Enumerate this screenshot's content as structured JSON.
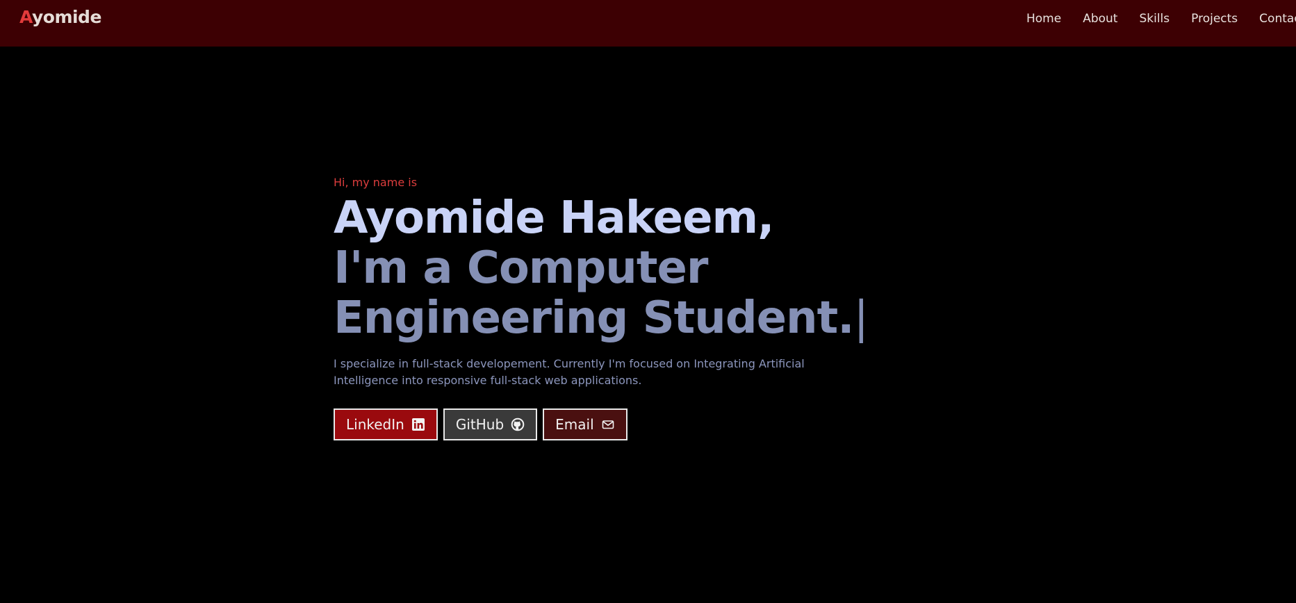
{
  "logo": {
    "initial": "A",
    "rest": "yomide"
  },
  "nav": {
    "items": [
      {
        "label": "Home"
      },
      {
        "label": "About"
      },
      {
        "label": "Skills"
      },
      {
        "label": "Projects"
      },
      {
        "label": "Contact"
      }
    ]
  },
  "hero": {
    "greeting": "Hi, my name is",
    "name_line": "Ayomide Hakeem,",
    "role_line1": "I'm a Computer",
    "role_line2": "Engineering Student.",
    "cursor": "|",
    "bio": "I specialize in full-stack developement. Currently I'm focused on Integrating Artificial Intelligence into responsive full-stack web applications."
  },
  "buttons": {
    "linkedin": {
      "label": "LinkedIn",
      "icon": "linkedin-icon"
    },
    "github": {
      "label": "GitHub",
      "icon": "github-icon"
    },
    "email": {
      "label": "Email",
      "icon": "mail-icon"
    }
  },
  "colors": {
    "navbar_bg": "#3d0003",
    "accent": "#dd3d3d",
    "page_bg": "#000000",
    "title_primary": "#c9d3f7",
    "title_secondary": "#8590b5",
    "linkedin_bg": "#9a0a0e",
    "github_bg": "#3a3a3a",
    "email_bg": "#4a1010"
  }
}
